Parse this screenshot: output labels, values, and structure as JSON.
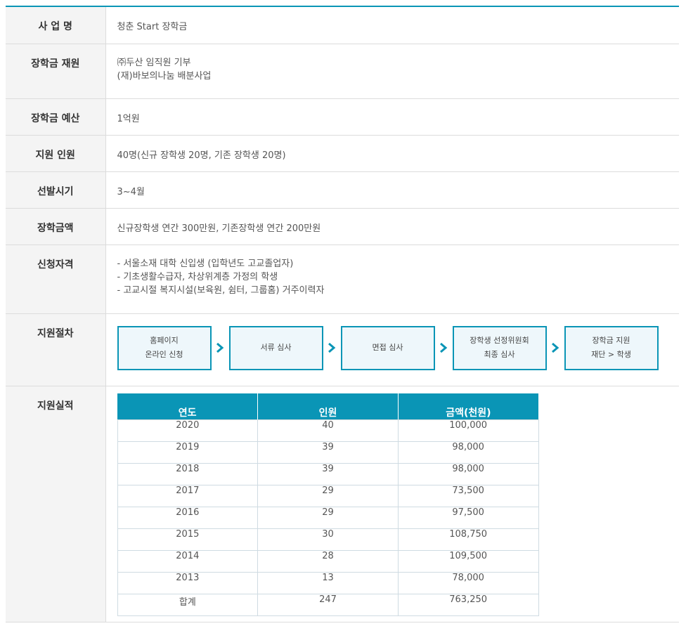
{
  "rows": {
    "name": {
      "label": "사 업 명",
      "value": "청춘 Start 장학금"
    },
    "source": {
      "label": "장학금 재원",
      "lines": [
        "㈜두산 임직원 기부",
        "(재)바보의나눔 배분사업"
      ]
    },
    "budget": {
      "label": "장학금 예산",
      "value": "1억원"
    },
    "recipients": {
      "label": "지원 인원",
      "value": "40명(신규 장학생 20명, 기존 장학생 20명)"
    },
    "period": {
      "label": "선발시기",
      "value": "3~4월"
    },
    "amount": {
      "label": "장학금액",
      "value": "신규장학생 연간 300만원, 기존장학생 연간 200만원"
    },
    "eligibility": {
      "label": "신청자격",
      "lines": [
        "- 서울소재 대학 신입생 (입학년도 고교졸업자)",
        "- 기초생활수급자, 차상위계층 가정의 학생",
        "- 고교시절 복지시설(보육원, 쉼터, 그룹홈) 거주이력자"
      ]
    },
    "procedure": {
      "label": "지원절차",
      "steps": [
        [
          "홈페이지",
          "온라인 신청"
        ],
        [
          "서류 심사"
        ],
        [
          "면접 심사"
        ],
        [
          "장학생 선정위원회",
          "최종 심사"
        ],
        [
          "장학금 지원",
          "재단 > 학생"
        ]
      ]
    },
    "results": {
      "label": "지원실적",
      "headers": [
        "연도",
        "인원",
        "금액(천원)"
      ],
      "data": [
        [
          "2020",
          "40",
          "100,000"
        ],
        [
          "2019",
          "39",
          "98,000"
        ],
        [
          "2018",
          "39",
          "98,000"
        ],
        [
          "2017",
          "29",
          "73,500"
        ],
        [
          "2016",
          "29",
          "97,500"
        ],
        [
          "2015",
          "30",
          "108,750"
        ],
        [
          "2014",
          "28",
          "109,500"
        ],
        [
          "2013",
          "13",
          "78,000"
        ],
        [
          "합계",
          "247",
          "763,250"
        ]
      ]
    }
  },
  "colors": {
    "accent": "#0a95b6",
    "header_bg": "#f4f4f4",
    "step_bg": "#eef7fb"
  },
  "icons": {
    "step_arrow": "chevron-right-icon"
  }
}
